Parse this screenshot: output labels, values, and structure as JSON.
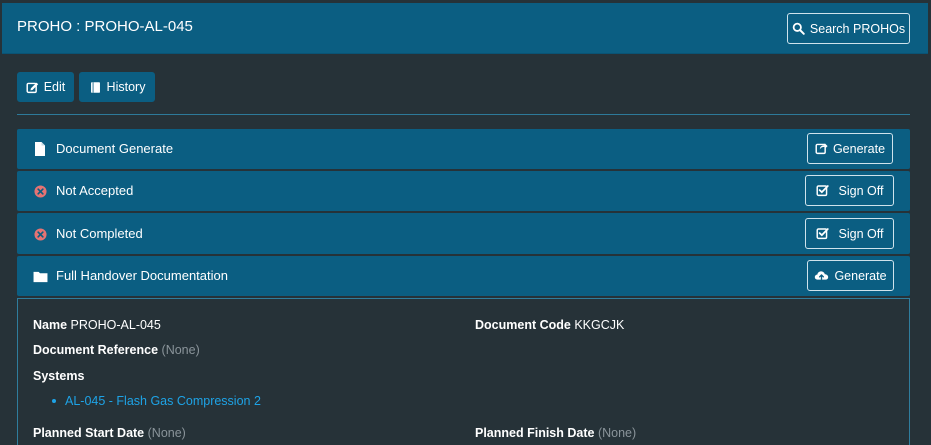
{
  "header": {
    "title": "PROHO : PROHO-AL-045",
    "search_label": "Search PROHOs"
  },
  "toolbar": {
    "edit_label": "Edit",
    "history_label": "History"
  },
  "rows": [
    {
      "label": "Document Generate",
      "action": "Generate",
      "icon": "file-icon"
    },
    {
      "label": "Not Accepted",
      "action": "Sign Off",
      "icon": "x-circle-icon"
    },
    {
      "label": "Not Completed",
      "action": "Sign Off",
      "icon": "x-circle-icon"
    },
    {
      "label": "Full Handover Documentation",
      "action": "Generate",
      "icon": "folder-icon"
    }
  ],
  "details": {
    "name_label": "Name",
    "name_value": "PROHO-AL-045",
    "doc_code_label": "Document Code",
    "doc_code_value": "KKGCJK",
    "doc_ref_label": "Document Reference",
    "doc_ref_value": "(None)",
    "systems_label": "Systems",
    "systems": [
      "AL-045 - Flash Gas Compression 2"
    ],
    "planned_start_label": "Planned Start Date",
    "planned_start_value": "(None)",
    "planned_finish_label": "Planned Finish Date",
    "planned_finish_value": "(None)"
  },
  "colors": {
    "background": "#263238",
    "primary": "#0b5e82",
    "link": "#1ea3e6",
    "status_error": "#e57373"
  }
}
